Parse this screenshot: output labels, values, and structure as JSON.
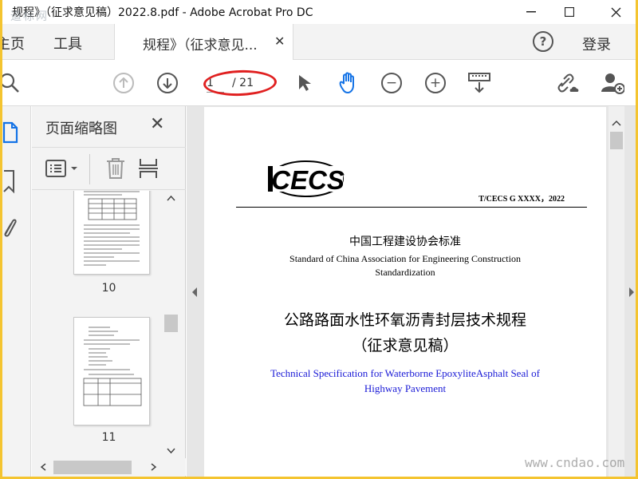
{
  "window": {
    "title": "规程》（征求意见稿）2022.8.pdf - Adobe Acrobat Pro DC",
    "watermark_top": "道标网"
  },
  "tabs": {
    "home": "主页",
    "tools": "工具",
    "document": "规程》（征求意见...",
    "login": "登录"
  },
  "toolbar": {
    "current_page": "1",
    "total_pages": "/ 21"
  },
  "thumbnails": {
    "panel_title": "页面缩略图",
    "pages": [
      {
        "number": "10"
      },
      {
        "number": "11"
      }
    ]
  },
  "document": {
    "logo_text": "CECS",
    "code": "T/CECS G XXXX，2022",
    "org_cn": "中国工程建设协会标准",
    "org_en_1": "Standard of China Association for Engineering Construction",
    "org_en_2": "Standardization",
    "title_cn": "公路路面水性环氧沥青封层技术规程",
    "subtitle_cn": "（征求意见稿）",
    "title_en_1": "Technical Specification for Waterborne EpoxyliteAsphalt Seal of",
    "title_en_2": "Highway Pavement"
  },
  "watermark_bottom": "www.cndao.com",
  "colors": {
    "accent_blue": "#1a1ad6",
    "highlight_red": "#e02020",
    "hand_tool_blue": "#1473e6"
  }
}
